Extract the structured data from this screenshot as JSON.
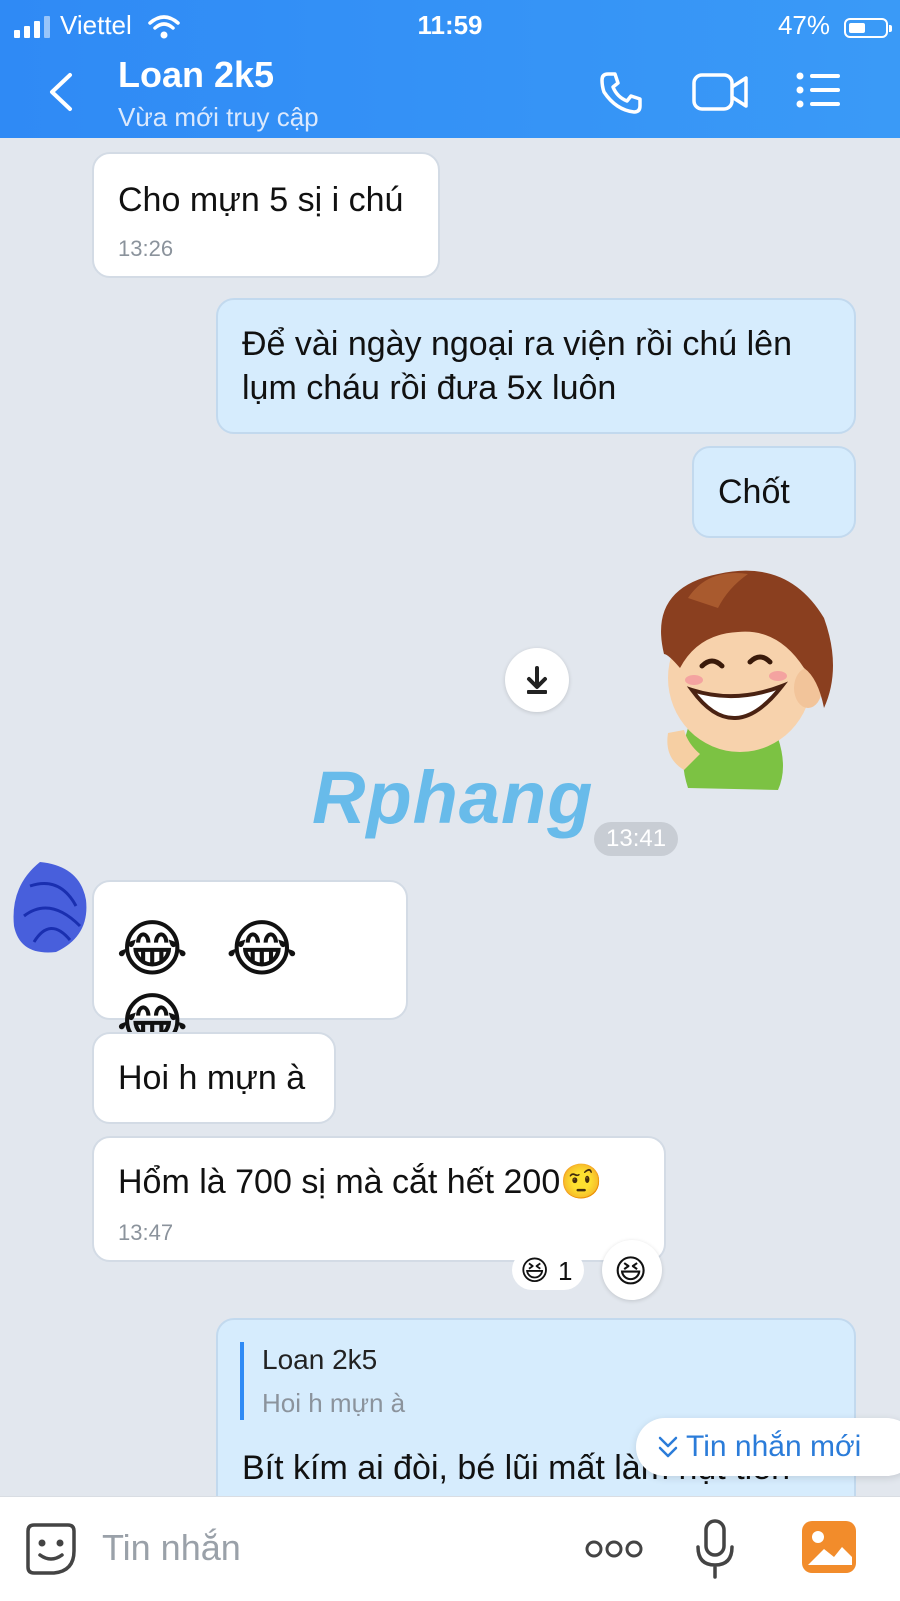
{
  "status": {
    "carrier": "Viettel",
    "time": "11:59",
    "battery": "47%"
  },
  "header": {
    "title": "Loan 2k5",
    "subtitle": "Vừa mới truy cập"
  },
  "messages": [
    {
      "text": "Cho mựn 5 sị i chú",
      "time": "13:26"
    },
    {
      "text": "Để vài ngày ngoại ra viện rồi chú lên lụm cháu rồi đưa 5x luôn"
    },
    {
      "text": "Chốt"
    },
    {
      "time": "13:41"
    },
    {
      "text": "😂 😂 😂"
    },
    {
      "text": "Hoi h mựn à"
    },
    {
      "text": "Hổm là 700 sị mà cắt hết 200🤨",
      "time": "13:47",
      "reaction_count": "1"
    },
    {
      "quote_name": "Loan 2k5",
      "quote_text": "Hoi h mựn à",
      "text": "Bít kím ai đòi, bé lũi mất làm hụt tiền"
    }
  ],
  "watermark": "Rphang",
  "new_messages": "Tin nhắn mới",
  "input": {
    "placeholder": "Tin nhắn"
  },
  "colors": {
    "header": "#3a9af7",
    "incoming": "#ffffff",
    "outgoing": "#d6ecfd",
    "background": "#e2e7ee"
  }
}
